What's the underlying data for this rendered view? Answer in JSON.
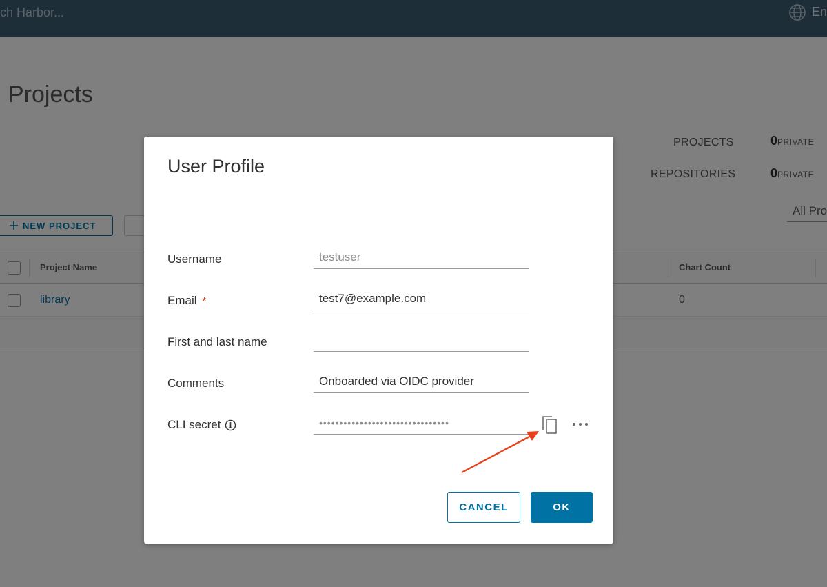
{
  "header": {
    "search_placeholder": "ch Harbor...",
    "language": "En"
  },
  "page": {
    "title": "Projects",
    "stats": {
      "projects_label": "PROJECTS",
      "projects_value": "0",
      "projects_sub": "PRIVATE",
      "repositories_label": "REPOSITORIES",
      "repositories_value": "0",
      "repositories_sub": "PRIVATE"
    },
    "new_project_label": "NEW PROJECT",
    "filter_label": "All Pro",
    "table": {
      "columns": [
        "Project Name",
        "Chart Count"
      ],
      "rows": [
        {
          "name": "library",
          "chart_count": "0"
        }
      ]
    }
  },
  "modal": {
    "title": "User Profile",
    "fields": {
      "username": {
        "label": "Username",
        "value": "testuser"
      },
      "email": {
        "label": "Email",
        "required_mark": "*",
        "value": "test7@example.com"
      },
      "name": {
        "label": "First and last name",
        "value": ""
      },
      "comments": {
        "label": "Comments",
        "value": "Onboarded via OIDC provider"
      },
      "cli_secret": {
        "label": "CLI secret",
        "value": "••••••••••••••••••••••••••••••••"
      }
    },
    "cancel_label": "CANCEL",
    "ok_label": "OK"
  },
  "colors": {
    "header_bg": "#3d5c73",
    "primary": "#0072a3",
    "annotation_arrow": "#e8401c",
    "required": "#e12200"
  },
  "icons": [
    "globe-icon",
    "plus-icon",
    "info-icon",
    "copy-icon",
    "more-icon"
  ]
}
